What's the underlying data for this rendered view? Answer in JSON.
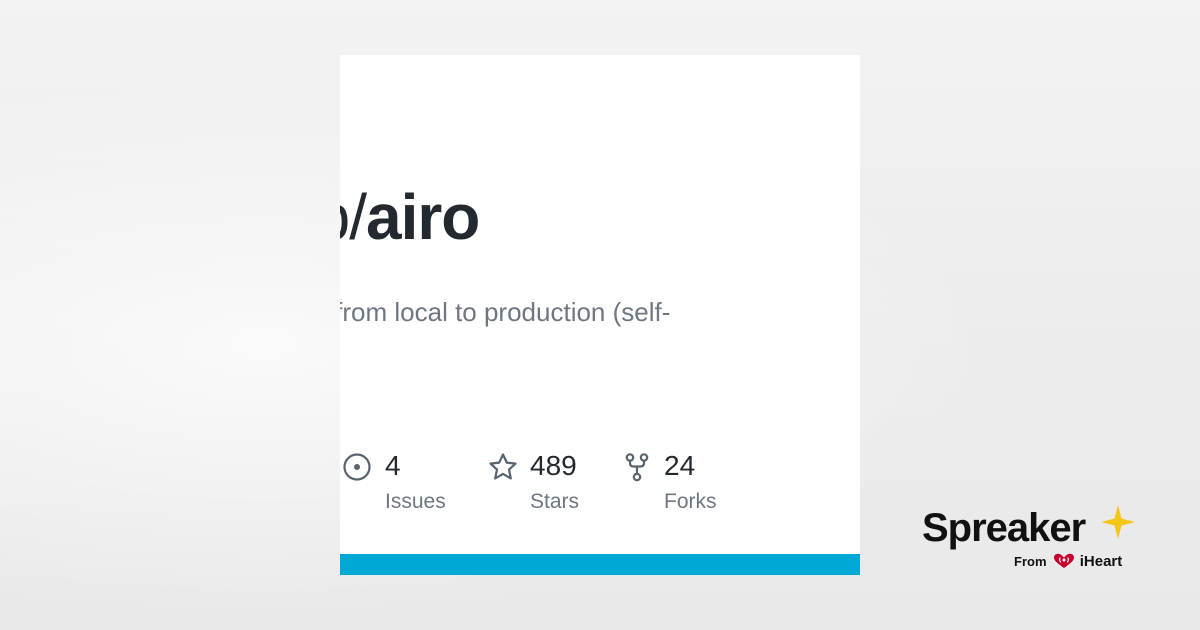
{
  "repo": {
    "owner_fragment": "ob",
    "separator": "/",
    "name": "airo",
    "description_fragment": "ojects from local to production (self-"
  },
  "stats": {
    "issues": {
      "value": "4",
      "label": "Issues",
      "icon": "issue-opened-icon"
    },
    "stars": {
      "value": "489",
      "label": "Stars",
      "icon": "star-icon"
    },
    "forks": {
      "value": "24",
      "label": "Forks",
      "icon": "repo-forked-icon"
    }
  },
  "brand": {
    "name": "Spreaker",
    "from": "From",
    "partner": "iHeart",
    "star_icon": "star-icon",
    "heart_icon": "iheart-logo-icon"
  },
  "colors": {
    "accent_bar": "#00a8d6",
    "brand_star": "#f5c518",
    "iheart_red": "#c6002b",
    "title_text": "#24292f",
    "muted_text": "#6e7781"
  }
}
